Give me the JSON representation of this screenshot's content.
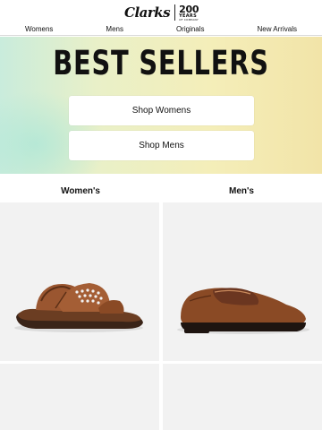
{
  "brand": {
    "logo_text": "Clarks",
    "anniversary_number": "200",
    "anniversary_word": "YEARS",
    "anniversary_sub": "OF COMPANY"
  },
  "nav": {
    "items": [
      {
        "label": "Womens"
      },
      {
        "label": "Mens"
      },
      {
        "label": "Originals"
      },
      {
        "label": "New Arrivals"
      }
    ]
  },
  "hero": {
    "title": "BEST SELLERS",
    "buttons": [
      {
        "label": "Shop Womens"
      },
      {
        "label": "Shop Mens"
      }
    ]
  },
  "categories": [
    {
      "label": "Women's",
      "image": "womens-sandal"
    },
    {
      "label": "Men's",
      "image": "mens-loafer"
    }
  ],
  "colors": {
    "brown": "#8a4a25",
    "tile_bg": "#f2f2f2"
  }
}
